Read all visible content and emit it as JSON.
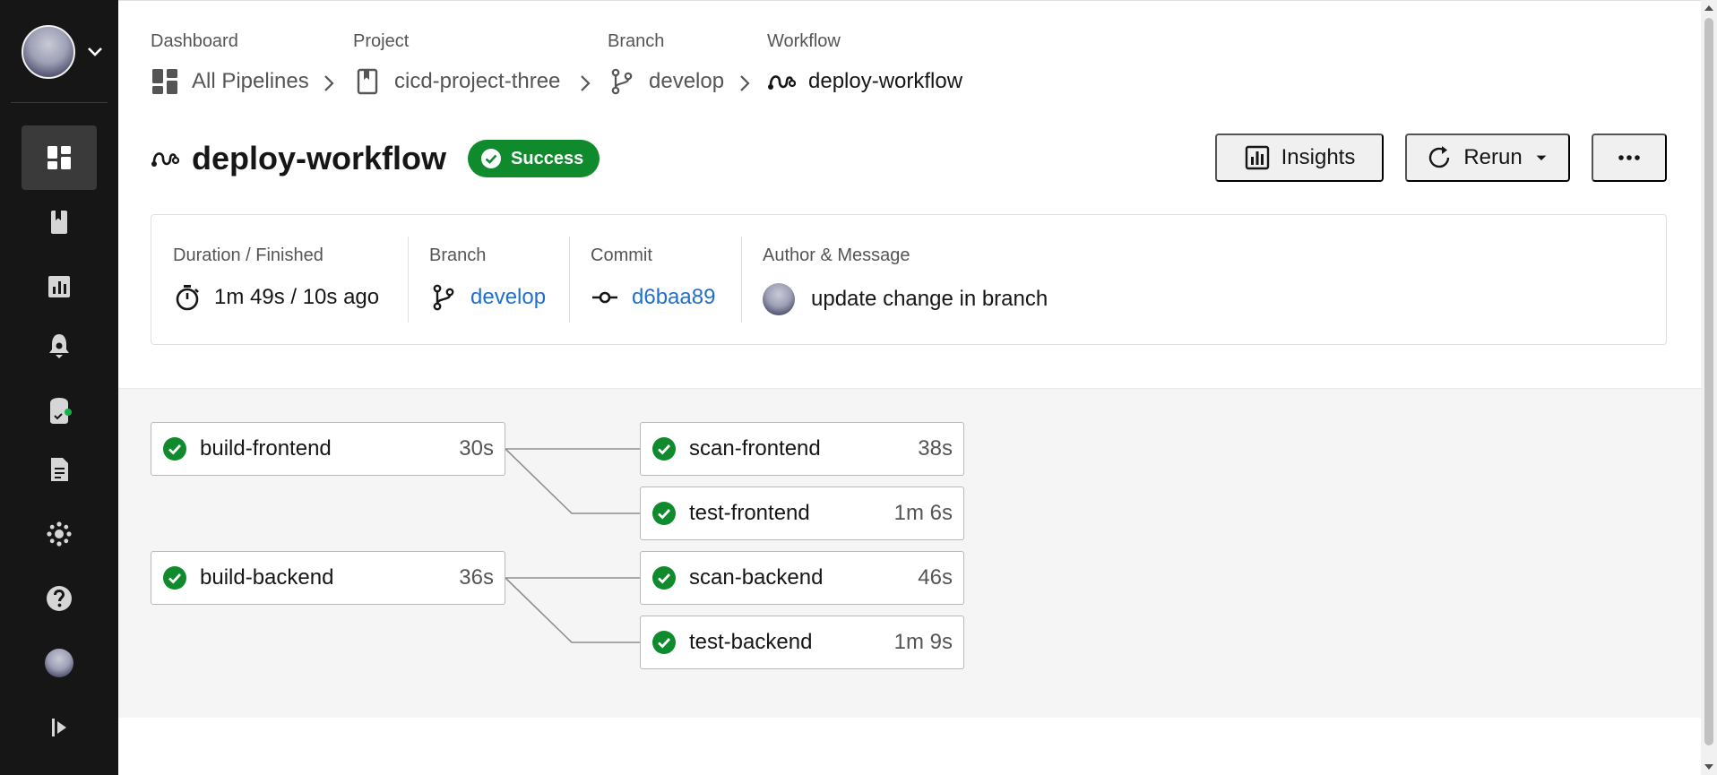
{
  "breadcrumbs": [
    {
      "label": "Dashboard",
      "value": "All Pipelines",
      "icon": "dashboard-icon"
    },
    {
      "label": "Project",
      "value": "cicd-project-three",
      "icon": "project-bookmark-icon"
    },
    {
      "label": "Branch",
      "value": "develop",
      "icon": "branch-icon"
    },
    {
      "label": "Workflow",
      "value": "deploy-workflow",
      "icon": "workflow-icon"
    }
  ],
  "header": {
    "title": "deploy-workflow",
    "status": "Success",
    "status_color": "#0f8a2d",
    "insights_label": "Insights",
    "rerun_label": "Rerun"
  },
  "summary": {
    "duration_label": "Duration / Finished",
    "duration_value": "1m 49s / 10s ago",
    "branch_label": "Branch",
    "branch_value": "develop",
    "commit_label": "Commit",
    "commit_value": "d6baa89",
    "author_label": "Author & Message",
    "author_message": "update change in branch",
    "link_color": "#1f6fd1"
  },
  "jobs": [
    {
      "name": "build-frontend",
      "duration": "30s",
      "status": "success"
    },
    {
      "name": "scan-frontend",
      "duration": "38s",
      "status": "success"
    },
    {
      "name": "test-frontend",
      "duration": "1m 6s",
      "status": "success"
    },
    {
      "name": "build-backend",
      "duration": "36s",
      "status": "success"
    },
    {
      "name": "scan-backend",
      "duration": "46s",
      "status": "success"
    },
    {
      "name": "test-backend",
      "duration": "1m 9s",
      "status": "success"
    }
  ],
  "sidebar": {
    "items": [
      {
        "icon": "dashboard-icon",
        "active": true
      },
      {
        "icon": "projects-icon"
      },
      {
        "icon": "insights-icon"
      },
      {
        "icon": "deploys-icon"
      },
      {
        "icon": "runners-icon"
      },
      {
        "icon": "plans-icon"
      },
      {
        "icon": "organization-settings-icon"
      },
      {
        "icon": "help-icon"
      },
      {
        "icon": "user-avatar-icon"
      },
      {
        "icon": "expand-sidebar-icon"
      }
    ]
  }
}
